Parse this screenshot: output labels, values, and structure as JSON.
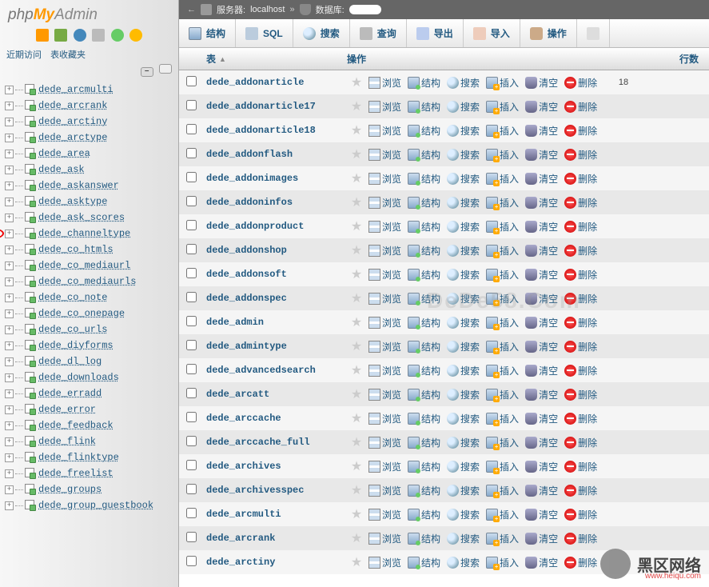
{
  "logo": {
    "php": "php",
    "my": "My",
    "admin": "Admin"
  },
  "nav": {
    "recent": "近期访问",
    "favorites": "表收藏夹"
  },
  "tree": [
    "dede_arcmulti",
    "dede_arcrank",
    "dede_arctiny",
    "dede_arctype",
    "dede_area",
    "dede_ask",
    "dede_askanswer",
    "dede_asktype",
    "dede_ask_scores",
    "dede_channeltype",
    "dede_co_htmls",
    "dede_co_mediaurl",
    "dede_co_mediaurls",
    "dede_co_note",
    "dede_co_onepage",
    "dede_co_urls",
    "dede_diyforms",
    "dede_dl_log",
    "dede_downloads",
    "dede_erradd",
    "dede_error",
    "dede_feedback",
    "dede_flink",
    "dede_flinktype",
    "dede_freelist",
    "dede_groups",
    "dede_group_guestbook"
  ],
  "highlight_index": 9,
  "breadcrumb": {
    "server_label": "服务器:",
    "server_value": "localhost",
    "db_label": "数据库:",
    "sep": "»"
  },
  "tabs": [
    "结构",
    "SQL",
    "搜索",
    "查询",
    "导出",
    "导入",
    "操作"
  ],
  "header": {
    "table": "表",
    "actions": "操作",
    "rows": "行数"
  },
  "actions": {
    "browse": "浏览",
    "structure": "结构",
    "search": "搜索",
    "insert": "插入",
    "empty": "清空",
    "drop": "删除"
  },
  "tables": [
    {
      "name": "dede_addonarticle",
      "rows": "18"
    },
    {
      "name": "dede_addonarticle17",
      "rows": ""
    },
    {
      "name": "dede_addonarticle18",
      "rows": ""
    },
    {
      "name": "dede_addonflash",
      "rows": ""
    },
    {
      "name": "dede_addonimages",
      "rows": ""
    },
    {
      "name": "dede_addoninfos",
      "rows": ""
    },
    {
      "name": "dede_addonproduct",
      "rows": ""
    },
    {
      "name": "dede_addonshop",
      "rows": ""
    },
    {
      "name": "dede_addonsoft",
      "rows": ""
    },
    {
      "name": "dede_addonspec",
      "rows": ""
    },
    {
      "name": "dede_admin",
      "rows": ""
    },
    {
      "name": "dede_admintype",
      "rows": ""
    },
    {
      "name": "dede_advancedsearch",
      "rows": ""
    },
    {
      "name": "dede_arcatt",
      "rows": ""
    },
    {
      "name": "dede_arccache",
      "rows": ""
    },
    {
      "name": "dede_arccache_full",
      "rows": ""
    },
    {
      "name": "dede_archives",
      "rows": ""
    },
    {
      "name": "dede_archivesspec",
      "rows": ""
    },
    {
      "name": "dede_arcmulti",
      "rows": ""
    },
    {
      "name": "dede_arcrank",
      "rows": ""
    },
    {
      "name": "dede_arctiny",
      "rows": ""
    }
  ],
  "watermark": {
    "text": "黑区网络",
    "url": "www.heiqu.com",
    "mid": "DeDe58.Com"
  }
}
